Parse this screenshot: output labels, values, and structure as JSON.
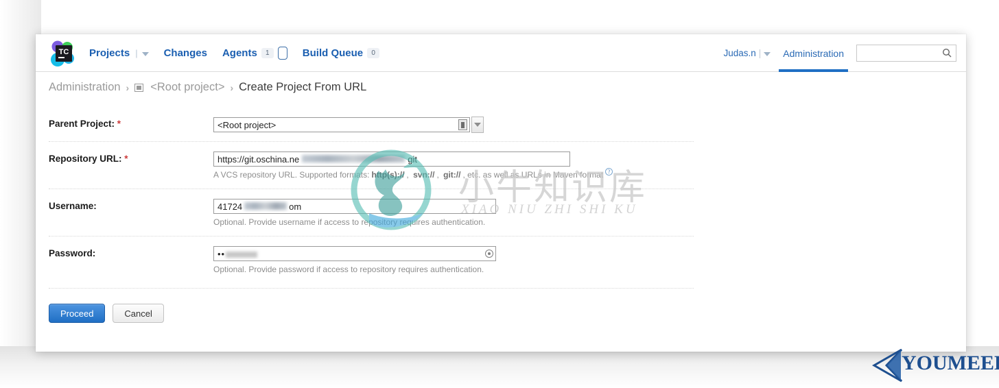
{
  "header": {
    "logo_text": "TC",
    "nav": [
      {
        "label": "Projects",
        "has_caret": true,
        "badge": null
      },
      {
        "label": "Changes",
        "has_caret": false,
        "badge": null
      },
      {
        "label": "Agents",
        "has_caret": false,
        "badge": "1",
        "extra_badge": true
      },
      {
        "label": "Build Queue",
        "has_caret": false,
        "badge": "0"
      }
    ],
    "user_name": "Judas.n",
    "admin_tab": "Administration",
    "search_value": "",
    "search_placeholder": "",
    "search_icon": "search-icon"
  },
  "breadcrumb": {
    "items": [
      {
        "label": "Administration",
        "type": "link"
      },
      {
        "label": "<Root project>",
        "type": "link",
        "icon": "project-icon"
      },
      {
        "label": "Create Project From URL",
        "type": "current"
      }
    ],
    "separator": "›"
  },
  "form": {
    "rows": [
      {
        "label": "Parent Project:",
        "required": true,
        "type": "select",
        "value": "<Root project>",
        "hint": null
      },
      {
        "label": "Repository URL:",
        "required": true,
        "type": "text",
        "value_prefix": "https://git.oschina.ne",
        "value_suffix": "git",
        "redacted": true,
        "hint_prefix": "A VCS repository URL. Supported formats: ",
        "hint_bold": [
          "http(s)://",
          "svn://",
          "git://"
        ],
        "hint_suffix": ", etc. as well as URLs in Maven format",
        "help_icon": "help-icon"
      },
      {
        "label": "Username:",
        "required": false,
        "type": "text",
        "value_prefix": "41724",
        "value_suffix": "om",
        "redacted": true,
        "hint": "Optional. Provide username if access to repository requires authentication."
      },
      {
        "label": "Password:",
        "required": false,
        "type": "password",
        "value": "••",
        "hint": "Optional. Provide password if access to repository requires authentication.",
        "reveal_icon": "password-reveal-icon"
      }
    ],
    "required_marker": "*"
  },
  "buttons": {
    "proceed": "Proceed",
    "cancel": "Cancel"
  },
  "watermarks": {
    "center_cn": "小牛知识库",
    "center_pinyin": "XIAO NIU ZHI SHI KU",
    "corner": "YOUMEEK"
  },
  "colors": {
    "accent": "#1f6fc4",
    "link": "#2a6ab5",
    "nav": "#1b5fb1",
    "required": "#cc3b3b",
    "hint": "#8d8d8d",
    "breadcrumb": "#9a9a9a"
  }
}
